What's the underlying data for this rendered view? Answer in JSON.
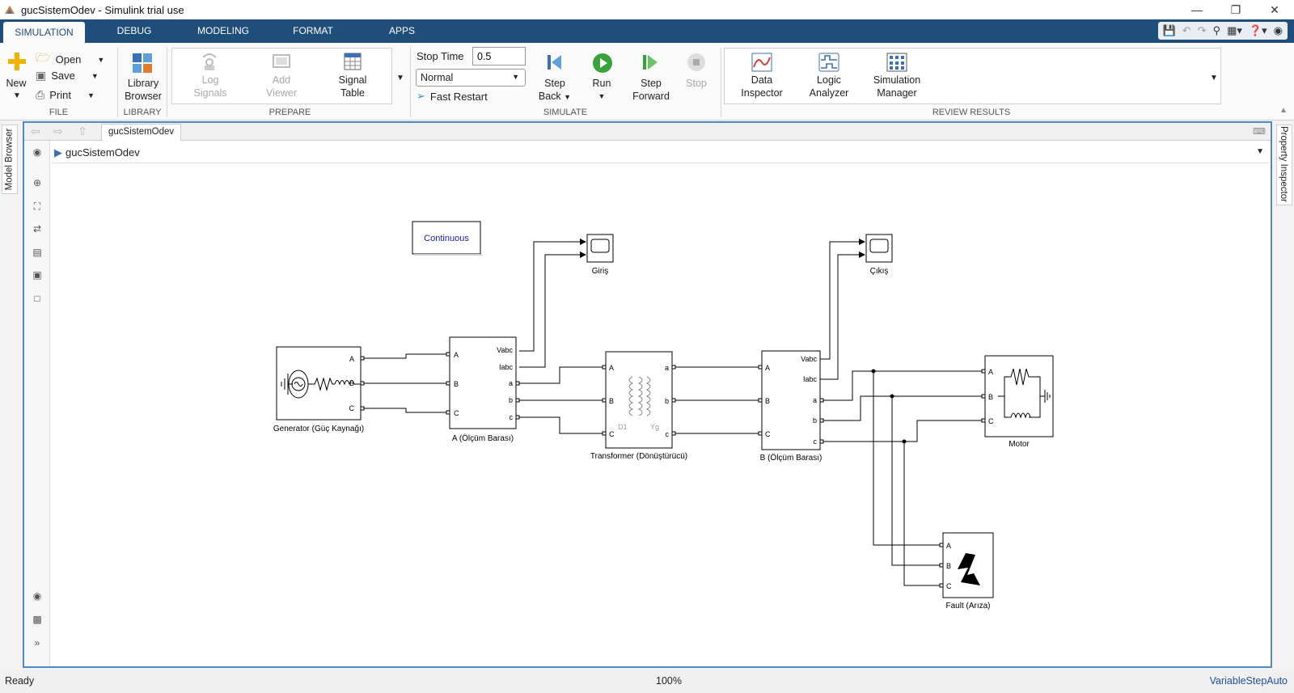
{
  "window": {
    "title": "gucSistemOdev - Simulink trial use",
    "controls": [
      "minimize-icon",
      "restore-icon",
      "close-icon"
    ]
  },
  "ribbon": {
    "tabs": [
      {
        "label": "SIMULATION",
        "active": true
      },
      {
        "label": "DEBUG",
        "active": false
      },
      {
        "label": "MODELING",
        "active": false
      },
      {
        "label": "FORMAT",
        "active": false
      },
      {
        "label": "APPS",
        "active": false
      }
    ],
    "file": {
      "section": "FILE",
      "new_label": "New",
      "open_label": "Open",
      "save_label": "Save",
      "print_label": "Print"
    },
    "library": {
      "section": "LIBRARY",
      "browser_line1": "Library",
      "browser_line2": "Browser"
    },
    "prepare": {
      "section": "PREPARE",
      "log_line1": "Log",
      "log_line2": "Signals",
      "viewer_line1": "Add",
      "viewer_line2": "Viewer",
      "table_line1": "Signal",
      "table_line2": "Table"
    },
    "simulate": {
      "section": "SIMULATE",
      "stop_time_label": "Stop Time",
      "stop_time_value": "0.5",
      "mode_value": "Normal",
      "fast_restart_label": "Fast Restart",
      "step_back_line1": "Step",
      "step_back_line2": "Back",
      "run_label": "Run",
      "step_fwd_line1": "Step",
      "step_fwd_line2": "Forward",
      "stop_label": "Stop"
    },
    "review": {
      "section": "REVIEW RESULTS",
      "data_line1": "Data",
      "data_line2": "Inspector",
      "logic_line1": "Logic",
      "logic_line2": "Analyzer",
      "simmgr_line1": "Simulation",
      "simmgr_line2": "Manager"
    }
  },
  "side_tabs": {
    "left": "Model Browser",
    "right": "Property Inspector"
  },
  "editor": {
    "doc_tab": "gucSistemOdev",
    "breadcrumb": "gucSistemOdev"
  },
  "model": {
    "powergui": "Continuous",
    "blocks": {
      "generator": {
        "label": "Generator (Güç Kaynağı)",
        "ports": [
          "A",
          "B",
          "C"
        ]
      },
      "meas_a": {
        "label": "A (Ölçüm Barası)",
        "in_ports": [
          "A",
          "B",
          "C"
        ],
        "out_ports": [
          "Vabc",
          "Iabc",
          "a",
          "b",
          "c"
        ]
      },
      "transformer": {
        "label": "Transformer (Dönüştürücü)",
        "in_ports": [
          "A",
          "B",
          "C"
        ],
        "out_ports": [
          "a",
          "b",
          "c"
        ],
        "winding1": "D1",
        "winding2": "Yg"
      },
      "meas_b": {
        "label": "B (Ölçüm Barası)",
        "in_ports": [
          "A",
          "B",
          "C"
        ],
        "out_ports": [
          "Vabc",
          "Iabc",
          "a",
          "b",
          "c"
        ]
      },
      "motor": {
        "label": "Motor",
        "ports": [
          "A",
          "B",
          "C"
        ]
      },
      "fault": {
        "label": "Fault (Arıza)",
        "ports": [
          "A",
          "B",
          "C"
        ]
      },
      "scope_in": {
        "label": "Giriş"
      },
      "scope_out": {
        "label": "Çıkış"
      }
    }
  },
  "status": {
    "left": "Ready",
    "zoom": "100%",
    "solver": "VariableStepAuto"
  }
}
